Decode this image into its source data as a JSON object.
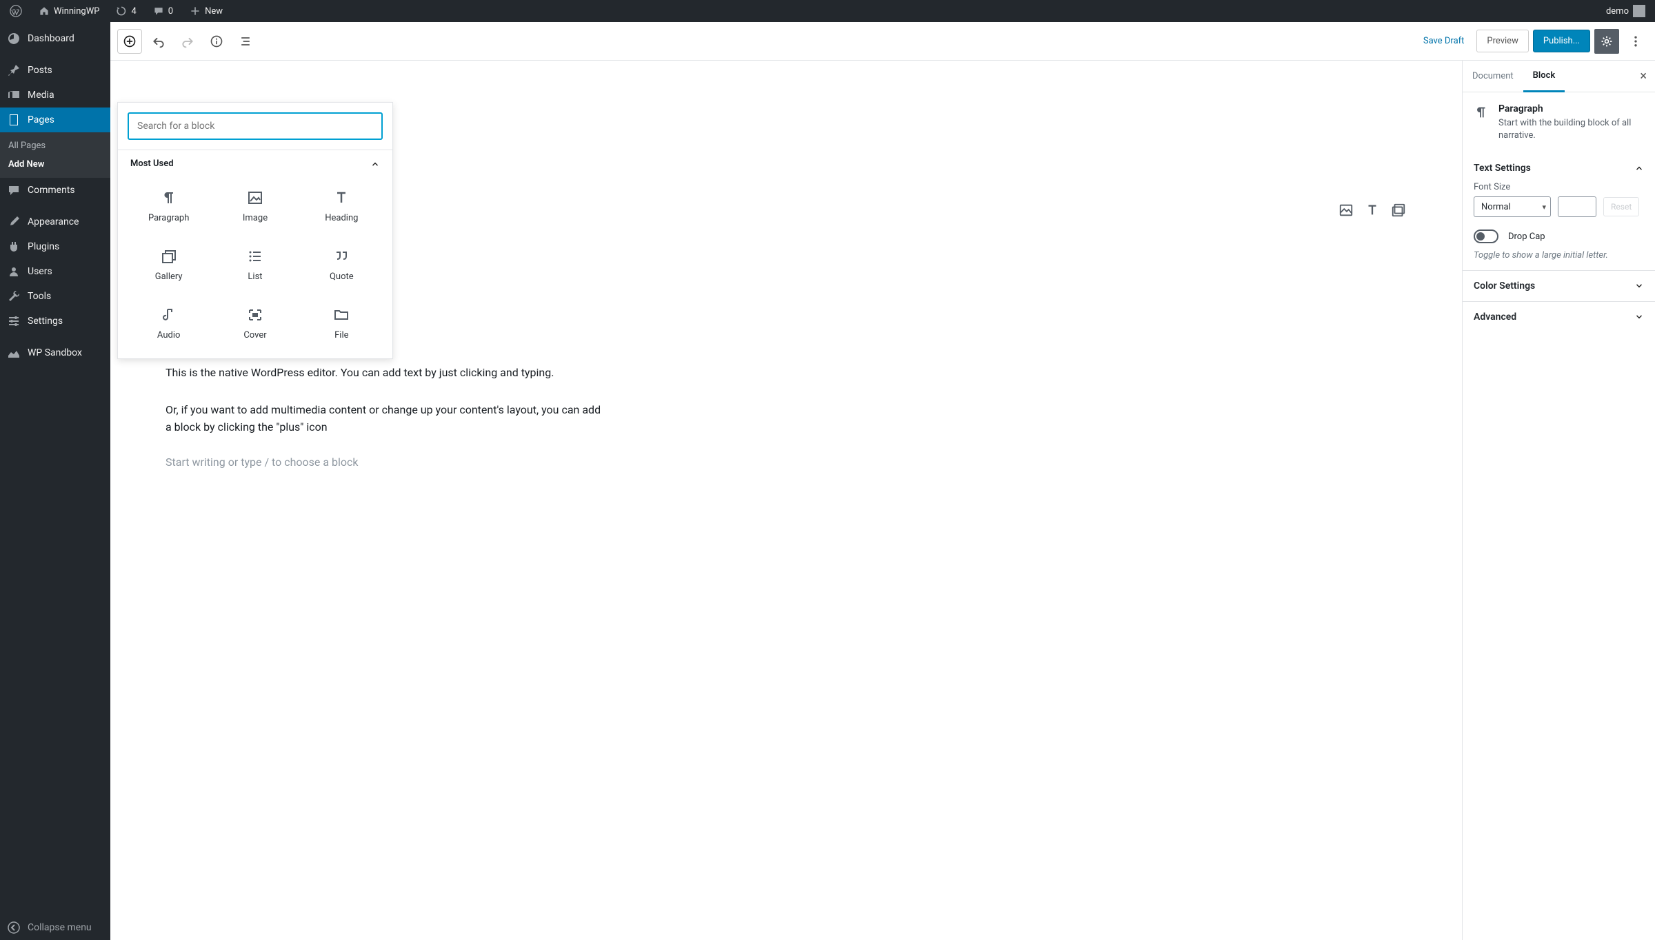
{
  "adminbar": {
    "site_name": "WinningWP",
    "updates_count": "4",
    "comments_count": "0",
    "new_label": "New",
    "user_label": "demo"
  },
  "sidebar": {
    "items": [
      {
        "label": "Dashboard"
      },
      {
        "label": "Posts"
      },
      {
        "label": "Media"
      },
      {
        "label": "Pages"
      },
      {
        "label": "Comments"
      },
      {
        "label": "Appearance"
      },
      {
        "label": "Plugins"
      },
      {
        "label": "Users"
      },
      {
        "label": "Tools"
      },
      {
        "label": "Settings"
      },
      {
        "label": "WP Sandbox"
      }
    ],
    "pages_sub": {
      "all": "All Pages",
      "add": "Add New"
    },
    "collapse_label": "Collapse menu"
  },
  "toolbar": {
    "save_draft": "Save Draft",
    "preview": "Preview",
    "publish": "Publish..."
  },
  "inserter": {
    "search_placeholder": "Search for a block",
    "section_title": "Most Used",
    "blocks": {
      "paragraph": "Paragraph",
      "image": "Image",
      "heading": "Heading",
      "gallery": "Gallery",
      "list": "List",
      "quote": "Quote",
      "audio": "Audio",
      "cover": "Cover",
      "file": "File"
    }
  },
  "canvas": {
    "para1": "This is the native WordPress editor. You can add text by just clicking and typing.",
    "para2": "Or, if you want to add multimedia content or change up your content's layout, you can add a block by clicking the \"plus\" icon",
    "placeholder": "Start writing or type / to choose a block"
  },
  "settings": {
    "tabs": {
      "document": "Document",
      "block": "Block"
    },
    "block": {
      "title": "Paragraph",
      "desc": "Start with the building block of all narrative."
    },
    "text_settings": {
      "heading": "Text Settings",
      "font_size_label": "Font Size",
      "font_size_value": "Normal",
      "reset_label": "Reset",
      "dropcap_label": "Drop Cap",
      "dropcap_helper": "Toggle to show a large initial letter."
    },
    "color_settings_heading": "Color Settings",
    "advanced_heading": "Advanced"
  }
}
